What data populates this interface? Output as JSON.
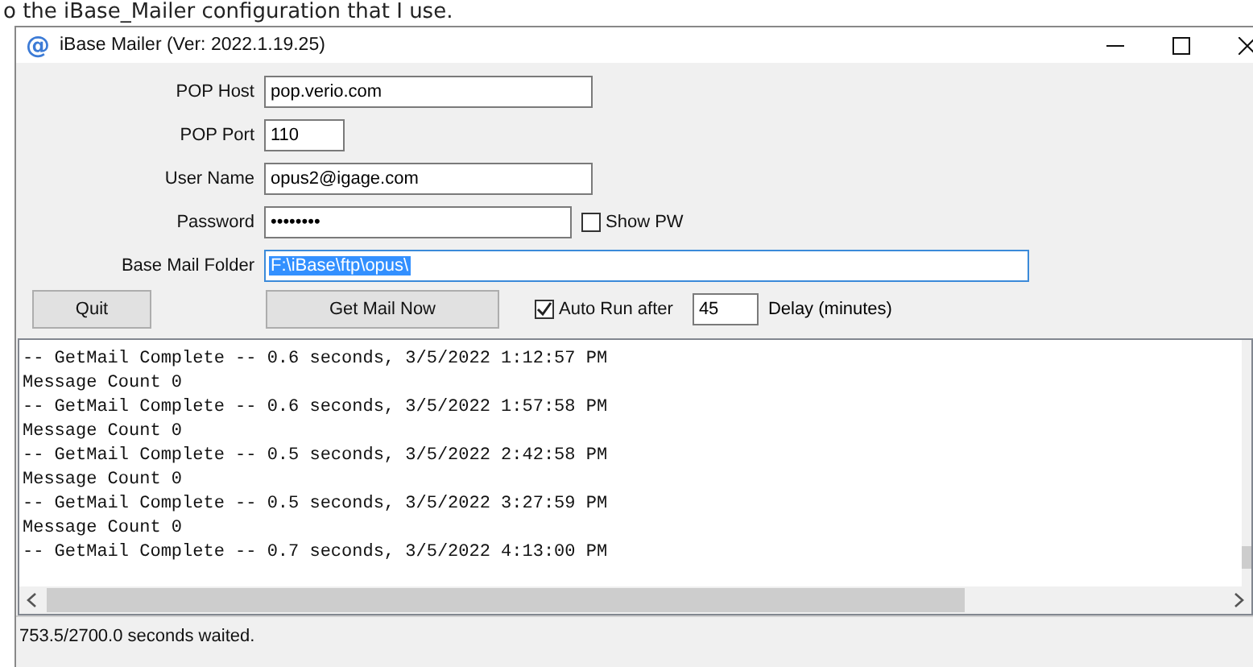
{
  "page_text": "o the iBase_Mailer configuration that I use.",
  "window": {
    "icon": "@",
    "title": "iBase Mailer (Ver: 2022.1.19.25)"
  },
  "form": {
    "fields": [
      {
        "label": "POP Host",
        "value": "pop.verio.com",
        "text_selected": false
      },
      {
        "label": "POP Port",
        "value": "110",
        "text_selected": false
      },
      {
        "label": "User Name",
        "value": "opus2@igage.com",
        "text_selected": false
      },
      {
        "label": "Password",
        "value": "••••••••",
        "text_selected": false,
        "checkbox": {
          "label": "Show PW",
          "checked": false
        }
      },
      {
        "label": "Base Mail Folder",
        "value": "F:\\iBase\\ftp\\opus\\",
        "text_selected": true
      }
    ]
  },
  "actions": {
    "quit": "Quit",
    "get_mail": "Get Mail Now",
    "auto_run": {
      "label": "Auto Run after",
      "checked": true
    },
    "delay_value": "45",
    "delay_label": "Delay (minutes)"
  },
  "log": [
    "-- GetMail Complete -- 0.6 seconds, 3/5/2022 1:12:57 PM",
    "Message Count 0",
    "-- GetMail Complete -- 0.6 seconds, 3/5/2022 1:57:58 PM",
    "Message Count 0",
    "-- GetMail Complete -- 0.5 seconds, 3/5/2022 2:42:58 PM",
    "Message Count 0",
    "-- GetMail Complete -- 0.5 seconds, 3/5/2022 3:27:59 PM",
    "Message Count 0",
    "-- GetMail Complete -- 0.7 seconds, 3/5/2022 4:13:00 PM"
  ],
  "status_bar": "753.5/2700.0 seconds waited."
}
